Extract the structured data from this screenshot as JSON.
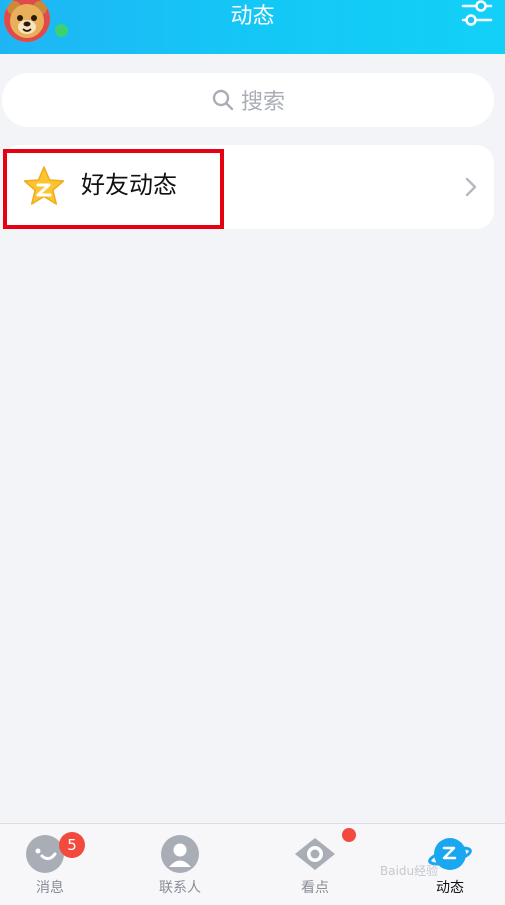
{
  "header": {
    "title": "动态",
    "avatar_icon": "bear-avatar",
    "status_color": "#3fd16f",
    "settings_icon": "sliders-icon"
  },
  "search": {
    "placeholder": "搜索",
    "icon": "search-icon"
  },
  "list": {
    "items": [
      {
        "label": "好友动态",
        "icon": "qzone-star-icon",
        "highlighted": true
      }
    ]
  },
  "tabbar": {
    "tabs": [
      {
        "label": "消息",
        "icon": "message-icon",
        "badge": "5"
      },
      {
        "label": "联系人",
        "icon": "contacts-icon"
      },
      {
        "label": "看点",
        "icon": "eye-icon",
        "dot": true
      },
      {
        "label": "动态",
        "icon": "planet-icon",
        "active": true
      }
    ]
  },
  "watermark": "Baidu经验",
  "colors": {
    "header_start": "#1fb5f5",
    "header_end": "#12d1f7",
    "highlight_border": "#e50012",
    "badge": "#f24a3c",
    "background": "#f3f4f8"
  }
}
